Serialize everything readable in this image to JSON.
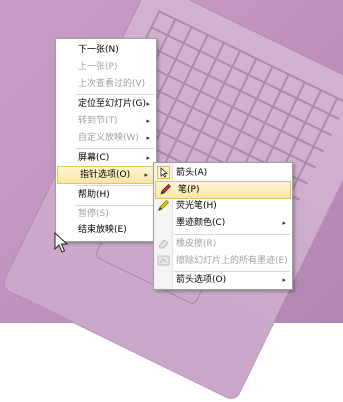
{
  "menu_main": {
    "items": [
      {
        "label": "下一张(N)",
        "disabled": false
      },
      {
        "label": "上一张(P)",
        "disabled": true
      },
      {
        "label": "上次查看过的(V)",
        "disabled": true
      },
      {
        "label": "定位至幻灯片(G)",
        "disabled": false,
        "submenu": true
      },
      {
        "label": "转到节(T)",
        "disabled": true,
        "submenu": true
      },
      {
        "label": "自定义放映(W)",
        "disabled": true,
        "submenu": true
      },
      {
        "label": "屏幕(C)",
        "disabled": false,
        "submenu": true
      },
      {
        "label": "指针选项(O)",
        "disabled": false,
        "submenu": true,
        "selected": true
      },
      {
        "label": "帮助(H)",
        "disabled": false
      },
      {
        "label": "暂停(S)",
        "disabled": true
      },
      {
        "label": "结束放映(E)",
        "disabled": false
      }
    ]
  },
  "menu_pointer": {
    "items": [
      {
        "label": "箭头(A)",
        "icon": "arrow-pointer-icon"
      },
      {
        "label": "笔(P)",
        "icon": "pen-icon",
        "selected": true
      },
      {
        "label": "荧光笔(H)",
        "icon": "highlighter-icon"
      },
      {
        "label": "墨迹颜色(C)",
        "submenu": true
      },
      {
        "label": "橡皮擦(R)",
        "icon": "eraser-icon",
        "disabled": true
      },
      {
        "label": "擦除幻灯片上的所有墨迹(E)",
        "icon": "erase-all-icon",
        "disabled": true
      },
      {
        "label": "箭头选项(O)",
        "submenu": true
      }
    ]
  },
  "submenu_arrow": "▸",
  "colors": {
    "highlight": "#f9e6a6",
    "pen_red": "#d03030",
    "highlighter_yellow": "#f0c400"
  }
}
